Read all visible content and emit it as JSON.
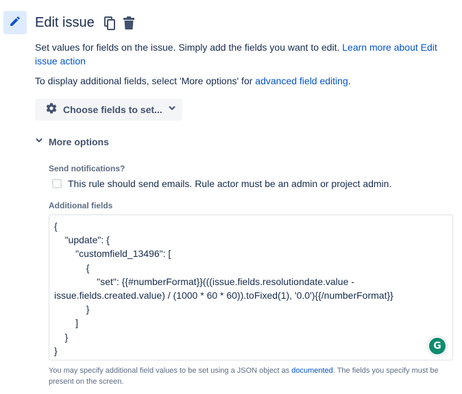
{
  "header": {
    "title": "Edit issue"
  },
  "description": {
    "intro": "Set values for fields on the issue. Simply add the fields you want to edit. ",
    "learn_more_link": "Learn more about Edit issue action",
    "display_prefix": "To display additional fields, select 'More options' for ",
    "advanced_link": "advanced field editing",
    "display_suffix": "."
  },
  "choose_fields": {
    "label": "Choose fields to set..."
  },
  "more_options": {
    "label": "More options"
  },
  "notifications": {
    "label": "Send notifications?",
    "checkbox_label": "This rule should send emails. Rule actor must be an admin or project admin.",
    "checked": false
  },
  "additional_fields": {
    "label": "Additional fields",
    "value": "{\n    \"update\": {\n        \"customfield_13496\": [\n            {\n                \"set\": {{#numberFormat}}(((issue.fields.resolutiondate.value - issue.fields.created.value) / (1000 * 60 * 60)).toFixed(1), '0.0'){{/numberFormat}}\n            }\n        ]\n    }\n}",
    "helper_prefix": "You may specify additional field values to be set using a JSON object as ",
    "helper_link": "documented",
    "helper_suffix": ". The fields you specify must be present on the screen."
  },
  "grammarly": {
    "letter": "G"
  },
  "colors": {
    "tile_bg": "#deebff",
    "accent": "#0052cc",
    "text": "#172b4d",
    "subtle": "#5e6c84",
    "grammarly": "#15c39a"
  }
}
